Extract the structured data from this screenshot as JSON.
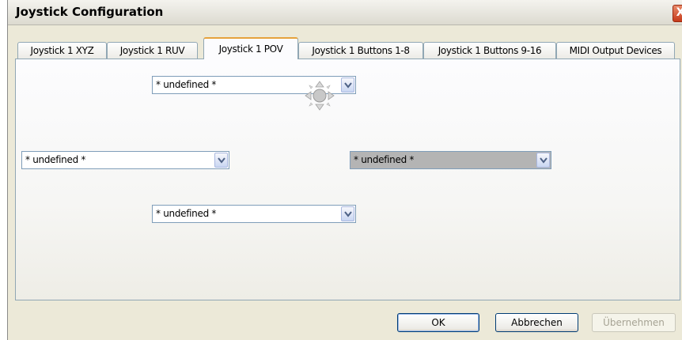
{
  "window": {
    "title": "Joystick Configuration",
    "close_label": "X"
  },
  "tabs": [
    {
      "label": "Joystick 1 XYZ"
    },
    {
      "label": "Joystick 1 RUV"
    },
    {
      "label": "Joystick 1 POV",
      "active": true
    },
    {
      "label": "Joystick 1 Buttons 1-8"
    },
    {
      "label": "Joystick 1 Buttons 9-16"
    },
    {
      "label": "MIDI Output Devices"
    }
  ],
  "pov": {
    "up": {
      "value": "* undefined *"
    },
    "left": {
      "value": "* undefined *"
    },
    "right": {
      "value": "* undefined *",
      "highlighted": true
    },
    "down": {
      "value": "* undefined *"
    },
    "icon": "pov-hat-icon"
  },
  "buttons": {
    "ok": "OK",
    "cancel": "Abbrechen",
    "apply": "Übernehmen"
  },
  "colors": {
    "accent_tab": "#e6a23c",
    "highlight_combo": "#b4b4b4"
  }
}
